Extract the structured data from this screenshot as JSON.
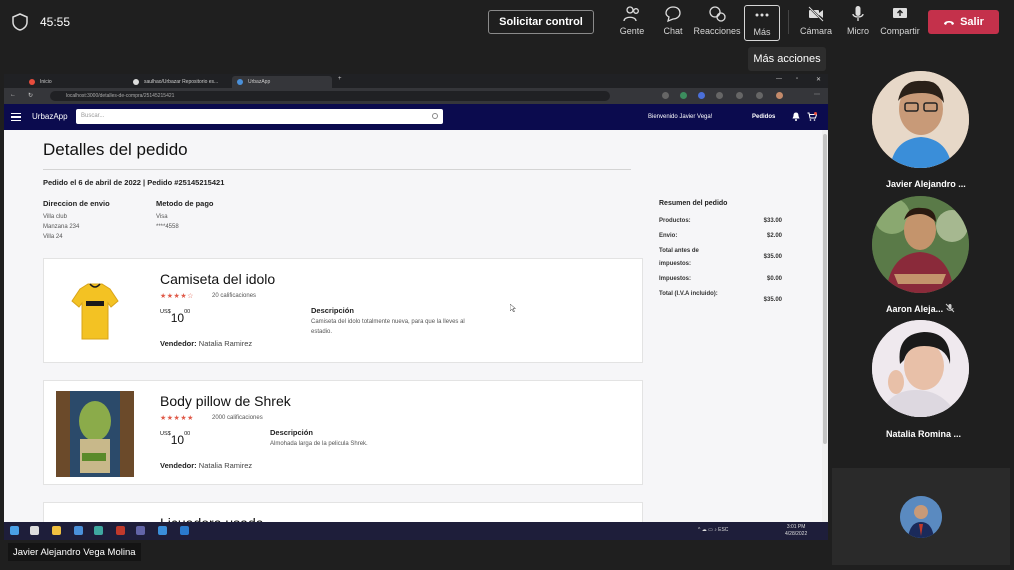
{
  "meeting": {
    "timer": "45:55",
    "request_control": "Solicitar control",
    "tools": {
      "people": "Gente",
      "chat": "Chat",
      "reactions": "Reacciones",
      "more": "Más",
      "camera": "Cámara",
      "mic": "Micro",
      "share": "Compartir"
    },
    "exit": "Salir",
    "tooltip": "Más acciones",
    "presenter": "Javier Alejandro Vega Molina",
    "participants": [
      {
        "name": "Javier Alejandro ..."
      },
      {
        "name": "Aaron Aleja..."
      },
      {
        "name": "Natalia Romina ..."
      }
    ]
  },
  "browser": {
    "tabs": [
      "Inicio",
      "saulhao/Urbazar Repositorio es...",
      "UrbazApp"
    ],
    "url": "localhost:3000/detalles-de-compra/25145215421"
  },
  "app": {
    "brand": "UrbazApp",
    "search_placeholder": "Buscar...",
    "welcome": "Bienvenido  Javier Vega!",
    "orders": "Pedidos",
    "cart_count": "1"
  },
  "order": {
    "title": "Detalles del pedido",
    "meta": "Pedido el 6 de abril de 2022   |   Pedido #25145215421",
    "shipping_label": "Direccion de envio",
    "shipping_lines": [
      "Villa club",
      "Manzana 234",
      "Villa 24"
    ],
    "payment_label": "Metodo de pago",
    "payment_lines": [
      "Visa",
      "****4558"
    ],
    "summary": {
      "title": "Resumen del pedido",
      "rows": [
        {
          "label": "Productos:",
          "value": "$33.00"
        },
        {
          "label": "Envio:",
          "value": "$2.00"
        },
        {
          "label": "Total antes de impuestos:",
          "value": "$35.00"
        },
        {
          "label": "Impuestos:",
          "value": "$0.00"
        },
        {
          "label": "Total (I.V.A incluido):",
          "value": "$35.00"
        }
      ]
    },
    "items": [
      {
        "name": "Camiseta del idolo",
        "stars": "★★★★☆",
        "ratings": "20 calificaciones",
        "currency": "US$",
        "price_int": "10",
        "price_dec": "00",
        "desc_label": "Descripción",
        "desc": "Camiseta del idolo totalmente nueva, para que la lleves al estadio.",
        "seller_label": "Vendedor:",
        "seller": "Natalia Ramirez"
      },
      {
        "name": "Body pillow de Shrek",
        "stars": "★★★★★",
        "ratings": "2000 calificaciones",
        "currency": "US$",
        "price_int": "10",
        "price_dec": "00",
        "desc_label": "Descripción",
        "desc": "Almohada larga de la pelicula Shrek.",
        "seller_label": "Vendedor:",
        "seller": "Natalia Ramirez"
      },
      {
        "name": "Licuadora usada"
      }
    ]
  },
  "taskbar": {
    "tray": "^  ☁  ▭  ♪  ESC",
    "time": "3:01 PM",
    "date": "4/28/2022"
  },
  "colors": {
    "exit_red": "#c4314b",
    "app_nav": "#0b0b4e",
    "star": "#e05b4a"
  }
}
